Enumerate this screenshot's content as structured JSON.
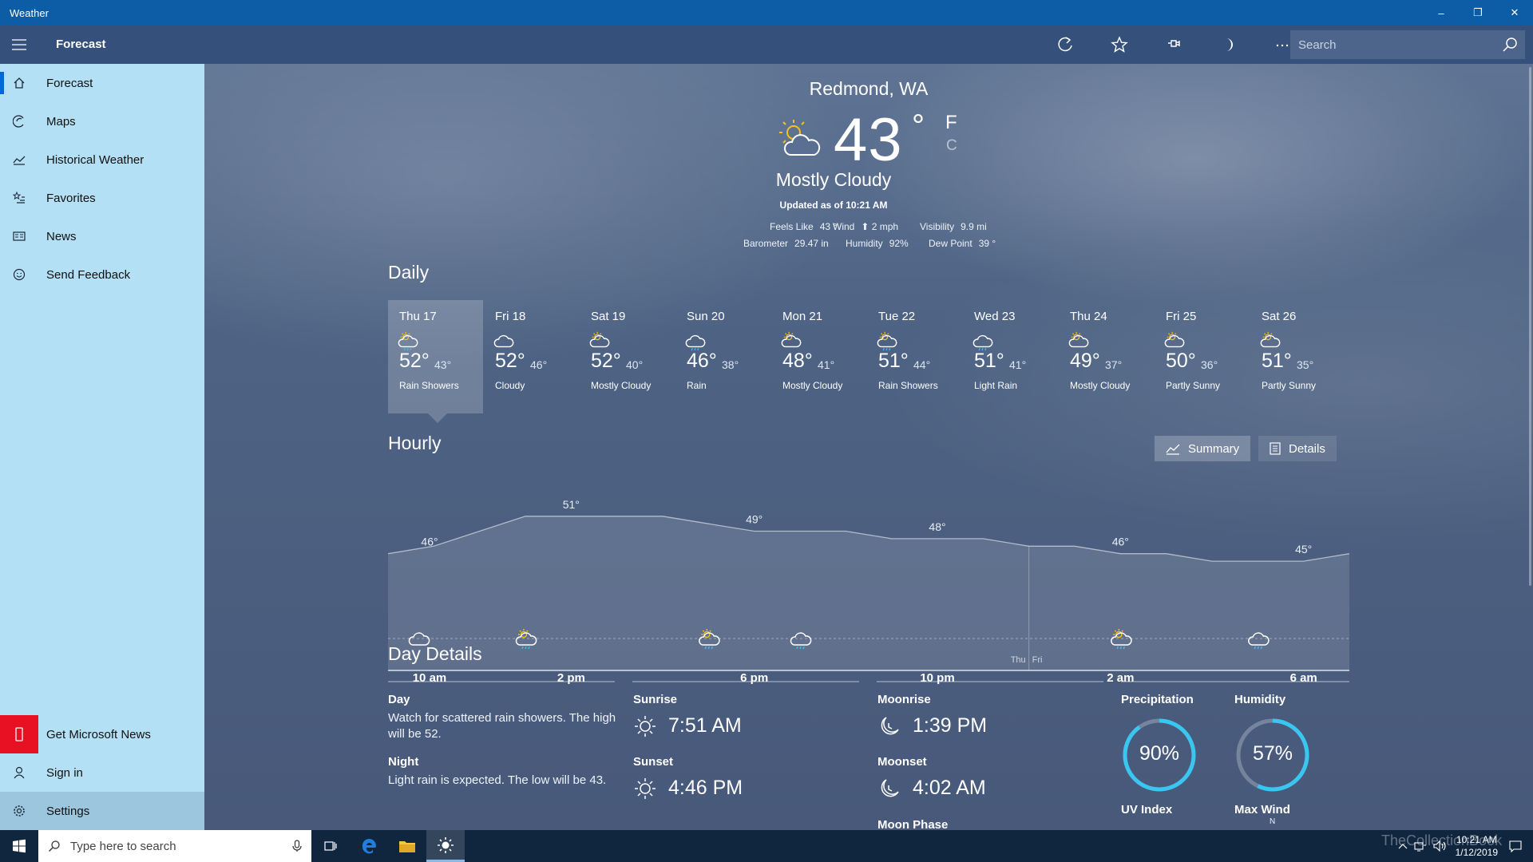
{
  "window": {
    "title": "Weather",
    "minimize": "–",
    "restore": "❐",
    "close": "✕"
  },
  "commandbar": {
    "title": "Forecast",
    "icons": [
      "refresh-icon",
      "star-icon",
      "pin-icon",
      "moon-icon",
      "more-icon"
    ],
    "search_placeholder": "Search"
  },
  "sidebar": {
    "items": [
      {
        "label": "Forecast",
        "icon": "home-icon"
      },
      {
        "label": "Maps",
        "icon": "map-icon"
      },
      {
        "label": "Historical Weather",
        "icon": "chart-icon"
      },
      {
        "label": "Favorites",
        "icon": "star-list-icon"
      },
      {
        "label": "News",
        "icon": "news-icon"
      },
      {
        "label": "Send Feedback",
        "icon": "smiley-icon"
      }
    ],
    "bottom": [
      {
        "label": "Get Microsoft News",
        "icon": "phone-icon"
      },
      {
        "label": "Sign in",
        "icon": "person-icon"
      },
      {
        "label": "Settings",
        "icon": "gear-icon"
      }
    ]
  },
  "current": {
    "location": "Redmond, WA",
    "temp": "43",
    "deg": "°",
    "unit_f": "F",
    "unit_c": "C",
    "condition": "Mostly Cloudy",
    "updated": "Updated as of 10:21 AM",
    "feels_like_label": "Feels Like",
    "feels_like": "43 °",
    "wind_label": "Wind",
    "wind": "⬆ 2 mph",
    "visibility_label": "Visibility",
    "visibility": "9.9 mi",
    "barometer_label": "Barometer",
    "barometer": "29.47 in",
    "humidity_label": "Humidity",
    "humidity": "92%",
    "dewpoint_label": "Dew Point",
    "dewpoint": "39 °"
  },
  "daily": {
    "title": "Daily",
    "days": [
      {
        "name": "Thu 17",
        "hi": "52°",
        "lo": "43°",
        "cond": "Rain Showers",
        "icon": "sun-rain-icon"
      },
      {
        "name": "Fri 18",
        "hi": "52°",
        "lo": "46°",
        "cond": "Cloudy",
        "icon": "cloud-icon"
      },
      {
        "name": "Sat 19",
        "hi": "52°",
        "lo": "40°",
        "cond": "Mostly Cloudy",
        "icon": "sun-cloud-icon"
      },
      {
        "name": "Sun 20",
        "hi": "46°",
        "lo": "38°",
        "cond": "Rain",
        "icon": "rain-icon"
      },
      {
        "name": "Mon 21",
        "hi": "48°",
        "lo": "41°",
        "cond": "Mostly Cloudy",
        "icon": "sun-cloud-icon"
      },
      {
        "name": "Tue 22",
        "hi": "51°",
        "lo": "44°",
        "cond": "Rain Showers",
        "icon": "sun-rain-icon"
      },
      {
        "name": "Wed 23",
        "hi": "51°",
        "lo": "41°",
        "cond": "Light Rain",
        "icon": "rain-icon"
      },
      {
        "name": "Thu 24",
        "hi": "49°",
        "lo": "37°",
        "cond": "Mostly Cloudy",
        "icon": "sun-cloud-icon"
      },
      {
        "name": "Fri 25",
        "hi": "50°",
        "lo": "36°",
        "cond": "Partly Sunny",
        "icon": "sun-cloud-icon"
      },
      {
        "name": "Sat 26",
        "hi": "51°",
        "lo": "35°",
        "cond": "Partly Sunny",
        "icon": "sun-cloud-icon"
      }
    ]
  },
  "hourly": {
    "title": "Hourly",
    "summary_label": "Summary",
    "details_label": "Details",
    "time_labels": [
      "10 am",
      "2 pm",
      "6 pm",
      "10 pm",
      "2 am",
      "6 am"
    ],
    "day_divider": [
      "Thu",
      "Fri"
    ]
  },
  "chart_data": {
    "type": "area",
    "x": [
      "10 am",
      "11 am",
      "12 pm",
      "1 pm",
      "2 pm",
      "3 pm",
      "4 pm",
      "5 pm",
      "6 pm",
      "7 pm",
      "8 pm",
      "9 pm",
      "10 pm",
      "11 pm",
      "12 am",
      "1 am",
      "2 am",
      "3 am",
      "4 am",
      "5 am",
      "6 am",
      "7 am"
    ],
    "values": [
      46,
      47,
      49,
      51,
      51,
      51,
      51,
      50,
      49,
      49,
      49,
      48,
      48,
      48,
      47,
      47,
      46,
      46,
      45,
      45,
      45,
      46
    ],
    "labels": [
      {
        "x": "10 am",
        "text": "46°"
      },
      {
        "x": "2 pm",
        "text": "51°"
      },
      {
        "x": "6 pm",
        "text": "49°"
      },
      {
        "x": "10 pm",
        "text": "48°"
      },
      {
        "x": "2 am",
        "text": "46°"
      },
      {
        "x": "6 am",
        "text": "45°"
      }
    ],
    "icons": [
      {
        "x": "10 am",
        "icon": "cloud-icon"
      },
      {
        "x": "1 pm",
        "icon": "sun-rain-icon"
      },
      {
        "x": "5 pm",
        "icon": "sun-rain-icon"
      },
      {
        "x": "7 pm",
        "icon": "rain-icon"
      },
      {
        "x": "2 am",
        "icon": "sun-rain-icon"
      },
      {
        "x": "5 am",
        "icon": "rain-icon"
      }
    ],
    "ylim": [
      40,
      53
    ],
    "grid": false
  },
  "details": {
    "title": "Day Details",
    "day_label": "Day",
    "day_text": "Watch for scattered rain showers. The high will be 52.",
    "night_label": "Night",
    "night_text": "Light rain is expected. The low will be 43.",
    "sunrise_label": "Sunrise",
    "sunrise": "7:51 AM",
    "sunset_label": "Sunset",
    "sunset": "4:46 PM",
    "moonrise_label": "Moonrise",
    "moonrise": "1:39 PM",
    "moonset_label": "Moonset",
    "moonset": "4:02 AM",
    "moonphase_label": "Moon Phase",
    "precip_label": "Precipitation",
    "precip": "90%",
    "precip_value": 0.9,
    "humidity_label": "Humidity",
    "humidity": "57%",
    "humidity_value": 0.57,
    "uv_label": "UV Index",
    "wind_label": "Max Wind",
    "wind_dir": "N"
  },
  "taskbar": {
    "search_placeholder": "Type here to search",
    "time": "10:21 AM",
    "date": "1/12/2019",
    "watermark": "TheCollectionBook"
  },
  "colors": {
    "accent_ring": "#39c6f0",
    "sidebar": "#b3e0f5",
    "titlebar": "#0d5ca6"
  }
}
